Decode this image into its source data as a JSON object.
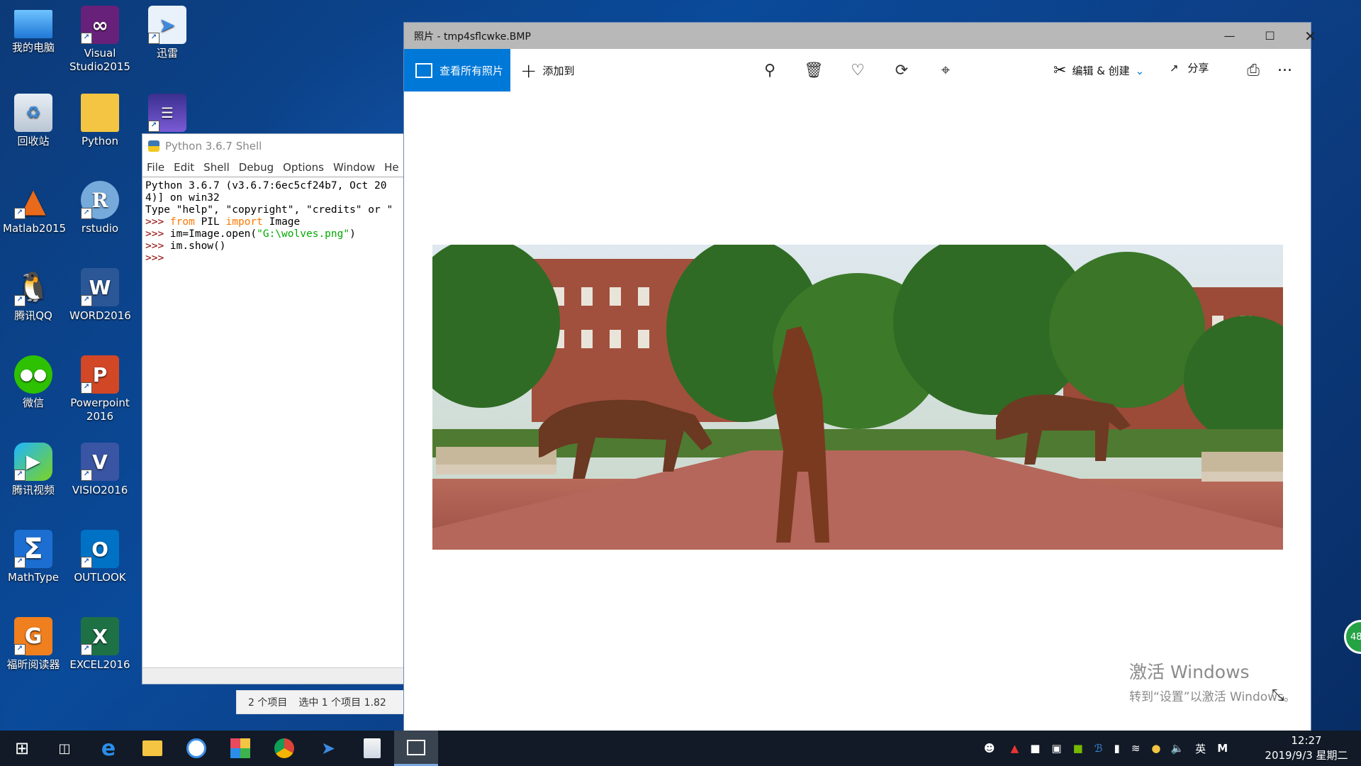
{
  "desktop": {
    "icons": [
      {
        "label": "我的电脑"
      },
      {
        "label": "Visual Studio2015"
      },
      {
        "label": "迅雷"
      },
      {
        "label": "回收站"
      },
      {
        "label": "Python"
      },
      {
        "label": "Matlab2015"
      },
      {
        "label": "rstudio"
      },
      {
        "label": "腾讯QQ"
      },
      {
        "label": "WORD2016"
      },
      {
        "label": "微信"
      },
      {
        "label": "Powerpoint2016"
      },
      {
        "label": "腾讯视频"
      },
      {
        "label": "VISIO2016"
      },
      {
        "label": "MathType"
      },
      {
        "label": "OUTLOOK"
      },
      {
        "label": "福昕阅读器"
      },
      {
        "label": "EXCEL2016"
      }
    ]
  },
  "shell": {
    "title": "Python 3.6.7 Shell",
    "menu": [
      "File",
      "Edit",
      "Shell",
      "Debug",
      "Options",
      "Window",
      "He"
    ],
    "lines": {
      "l1": "Python 3.6.7 (v3.6.7:6ec5cf24b7, Oct 20",
      "l2": "4)] on win32",
      "l3": "Type \"help\", \"copyright\", \"credits\" or \"",
      "prompt": ">>> ",
      "l4_kw1": "from",
      "l4_mid": " PIL ",
      "l4_kw2": "import",
      "l4_end": " Image",
      "l5_pre": "im=Image.open(",
      "l5_str": "\"G:\\wolves.png\"",
      "l5_end": ")",
      "l6": "im.show()",
      "l7": ">>>"
    }
  },
  "explorer_status": {
    "items": "2 个项目",
    "selected": "选中 1 个项目  1.82"
  },
  "photos": {
    "title": "照片 - tmp4sflcwke.BMP",
    "see_all": "查看所有照片",
    "add_to": "添加到",
    "edit_create": "编辑 & 创建",
    "share": "分享",
    "more": "...",
    "image_name": "wolves-statues-photo",
    "watermark_line1": "激活 Windows",
    "watermark_line2": "转到“设置”以激活 Windows。"
  },
  "taskbar": {
    "ime": "英",
    "time": "12:27",
    "date": "2019/9/3 星期二",
    "badge": "48"
  },
  "colors": {
    "accent": "#0078d7",
    "desktop": "#0b3f85",
    "taskbar": "#111a26"
  }
}
